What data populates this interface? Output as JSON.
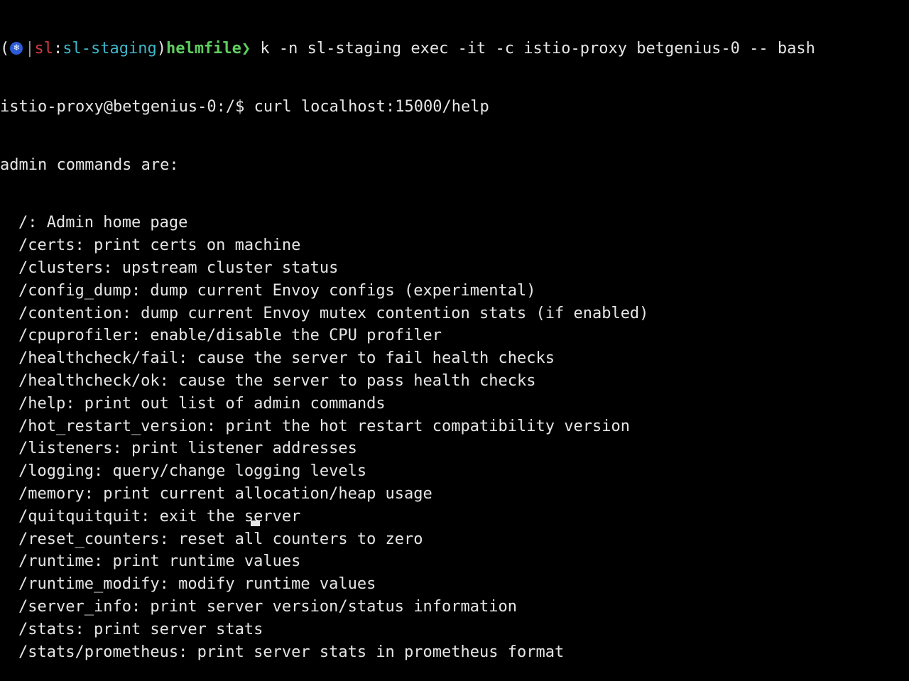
{
  "shell_prompt": {
    "open_paren": "(",
    "icon": "kubernetes-helm-icon",
    "icon_glyph": "❄",
    "separator": "|",
    "context": "sl",
    "colon": ":",
    "namespace": "sl-staging",
    "close_paren": ")",
    "directory": "helmfile",
    "arrow": "❯",
    "command": " k -n sl-staging exec -it -c istio-proxy betgenius-0 -- bash"
  },
  "container_prompt": {
    "text": "istio-proxy@betgenius-0:/$ curl localhost:15000/help"
  },
  "output_header": "admin commands are:",
  "commands": [
    "/: Admin home page",
    "/certs: print certs on machine",
    "/clusters: upstream cluster status",
    "/config_dump: dump current Envoy configs (experimental)",
    "/contention: dump current Envoy mutex contention stats (if enabled)",
    "/cpuprofiler: enable/disable the CPU profiler",
    "/healthcheck/fail: cause the server to fail health checks",
    "/healthcheck/ok: cause the server to pass health checks",
    "/help: print out list of admin commands",
    "/hot_restart_version: print the hot restart compatibility version",
    "/listeners: print listener addresses",
    "/logging: query/change logging levels",
    "/memory: print current allocation/heap usage",
    "/quitquitquit: exit the server",
    "/reset_counters: reset all counters to zero",
    "/runtime: print runtime values",
    "/runtime_modify: modify runtime values",
    "/server_info: print server version/status information",
    "/stats: print server stats",
    "/stats/prometheus: print server stats in prometheus format"
  ]
}
